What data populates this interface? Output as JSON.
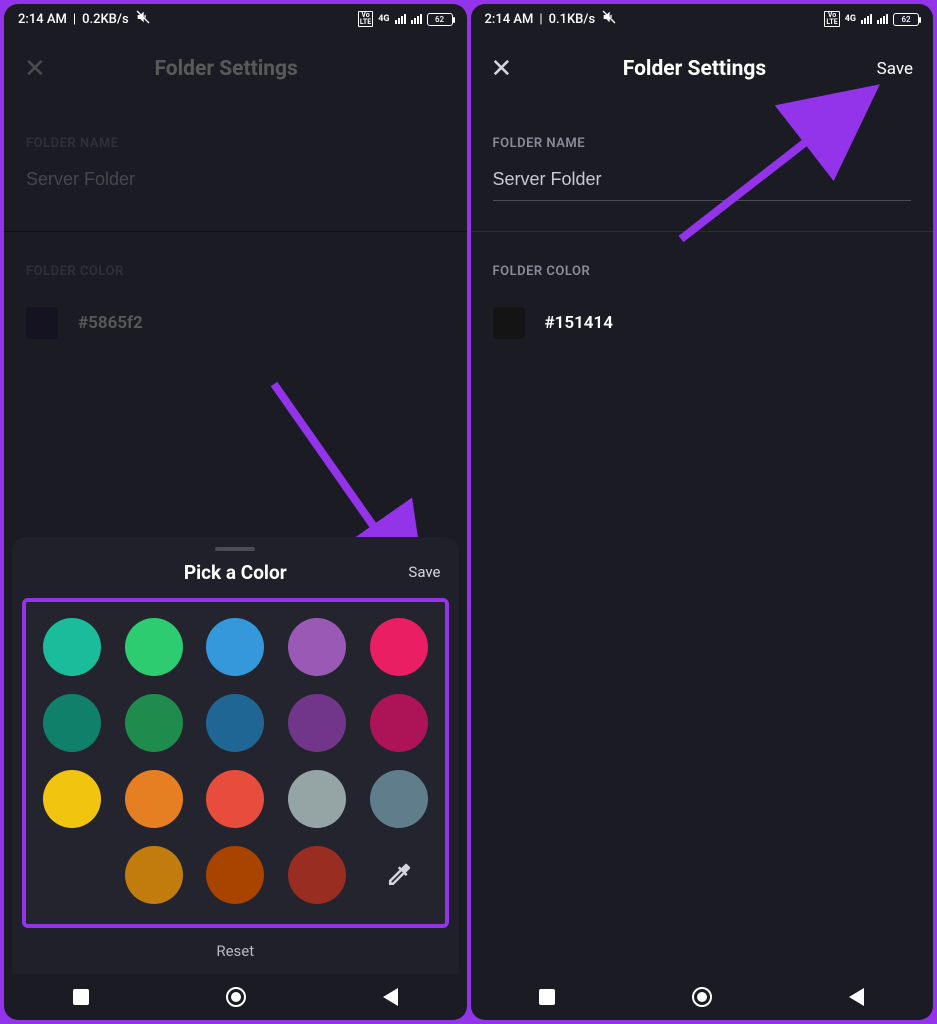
{
  "left": {
    "status": {
      "time": "2:14 AM",
      "speed": "0.2KB/s",
      "net": "4G",
      "battery": "62"
    },
    "header": {
      "title": "Folder Settings"
    },
    "folder_name_label": "FOLDER NAME",
    "folder_name_value": "Server Folder",
    "folder_color_label": "FOLDER COLOR",
    "folder_color_hex": "#5865f2",
    "folder_color_swatch": "#3b3360",
    "sheet": {
      "title": "Pick a Color",
      "save": "Save",
      "reset": "Reset"
    },
    "palette": [
      "#1abc9c",
      "#2ecc71",
      "#3498db",
      "#9b59b6",
      "#e91e63",
      "#11806a",
      "#1f8b4c",
      "#206694",
      "#71368a",
      "#ad1457",
      "#f1c40f",
      "#e67e22",
      "#e74c3c",
      "#95a5a6",
      "#607d8b",
      "#c27c0e",
      "#a84300",
      "#992d22"
    ]
  },
  "right": {
    "status": {
      "time": "2:14 AM",
      "speed": "0.1KB/s",
      "net": "4G",
      "battery": "62"
    },
    "header": {
      "title": "Folder Settings",
      "save": "Save"
    },
    "folder_name_label": "FOLDER NAME",
    "folder_name_value": "Server Folder",
    "folder_color_label": "FOLDER COLOR",
    "folder_color_hex": "#151414",
    "folder_color_swatch": "#151414"
  }
}
